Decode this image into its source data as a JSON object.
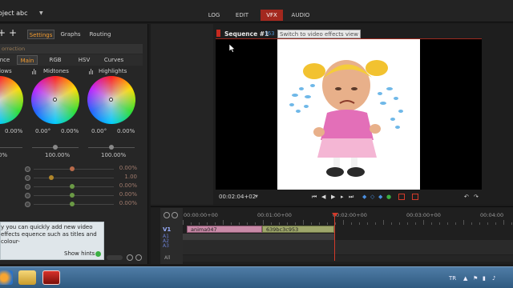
{
  "header": {
    "project_title": "oject abc",
    "project_dropdown": "▼",
    "tabs": [
      {
        "label": "LOG",
        "active": false
      },
      {
        "label": "EDIT",
        "active": false
      },
      {
        "label": "VFX",
        "active": true
      },
      {
        "label": "AUDIO",
        "active": false
      }
    ]
  },
  "left_panel": {
    "add_button": "+",
    "tabs": [
      {
        "label": "Settings",
        "active": true
      },
      {
        "label": "Graphs",
        "active": false
      },
      {
        "label": "Routing",
        "active": false
      }
    ],
    "section_header": "orrection",
    "cc_tabs": [
      {
        "label": "nce",
        "active": false
      },
      {
        "label": "Main",
        "active": true
      },
      {
        "label": "RGB",
        "active": false
      },
      {
        "label": "HSV",
        "active": false
      },
      {
        "label": "Curves",
        "active": false
      }
    ],
    "wheels": [
      {
        "label": "lows",
        "value_angle": "",
        "value_pct": "0.00%",
        "amount": "0%"
      },
      {
        "label": "Midtones",
        "value_angle": "0.00°",
        "value_pct": "0.00%",
        "amount": "100.00%"
      },
      {
        "label": "Highlights",
        "value_angle": "0.00°",
        "value_pct": "0.00%",
        "amount": "100.00%"
      }
    ],
    "adjustments": [
      {
        "value": "0.00%",
        "knob_color": "#b86a4a",
        "position": 0.48
      },
      {
        "value": "1.00",
        "knob_color": "#b0862a",
        "position": 0.22
      },
      {
        "value": "0.00%",
        "knob_color": "#6b9a45",
        "position": 0.48
      },
      {
        "value": "0.00%",
        "knob_color": "#6b9a45",
        "position": 0.48
      },
      {
        "value": "0.00%",
        "knob_color": "#6b9a45",
        "position": 0.48
      }
    ],
    "hint": {
      "text": "y you can quickly add new video effects equence such as titles and colour-",
      "show_hints_label": "Show hints",
      "dot_color": "#3cb043"
    }
  },
  "viewer": {
    "sequence_title": "Sequence #1",
    "sequence_bracket": "[63",
    "tooltip": "Switch to video effects view",
    "timecode": "00:02:04+02",
    "timecode_dropdown": "▼",
    "transport": [
      "⏮",
      "◀",
      "▶",
      "▸",
      "⏭"
    ],
    "extra_controls": [
      "◆",
      "◇",
      "◆",
      "●"
    ],
    "right_controls": [
      "↶",
      "↷"
    ]
  },
  "timeline": {
    "timecodes": [
      "00:00:00+00",
      "00:01:00+00",
      "00:02:00+00",
      "00:03:00+00",
      "00:04:00"
    ],
    "track_labels": {
      "video": "V1",
      "audio": [
        "A1",
        "A2",
        "A3"
      ],
      "all": "All"
    },
    "clips": [
      {
        "name": "anima047",
        "color": "#c98aa8"
      },
      {
        "name": "639bc3c953",
        "color": "#9fa76b"
      }
    ]
  },
  "taskbar": {
    "language": "TR",
    "tray_icons": [
      "▲",
      "⚑",
      "▮",
      "♪"
    ]
  }
}
